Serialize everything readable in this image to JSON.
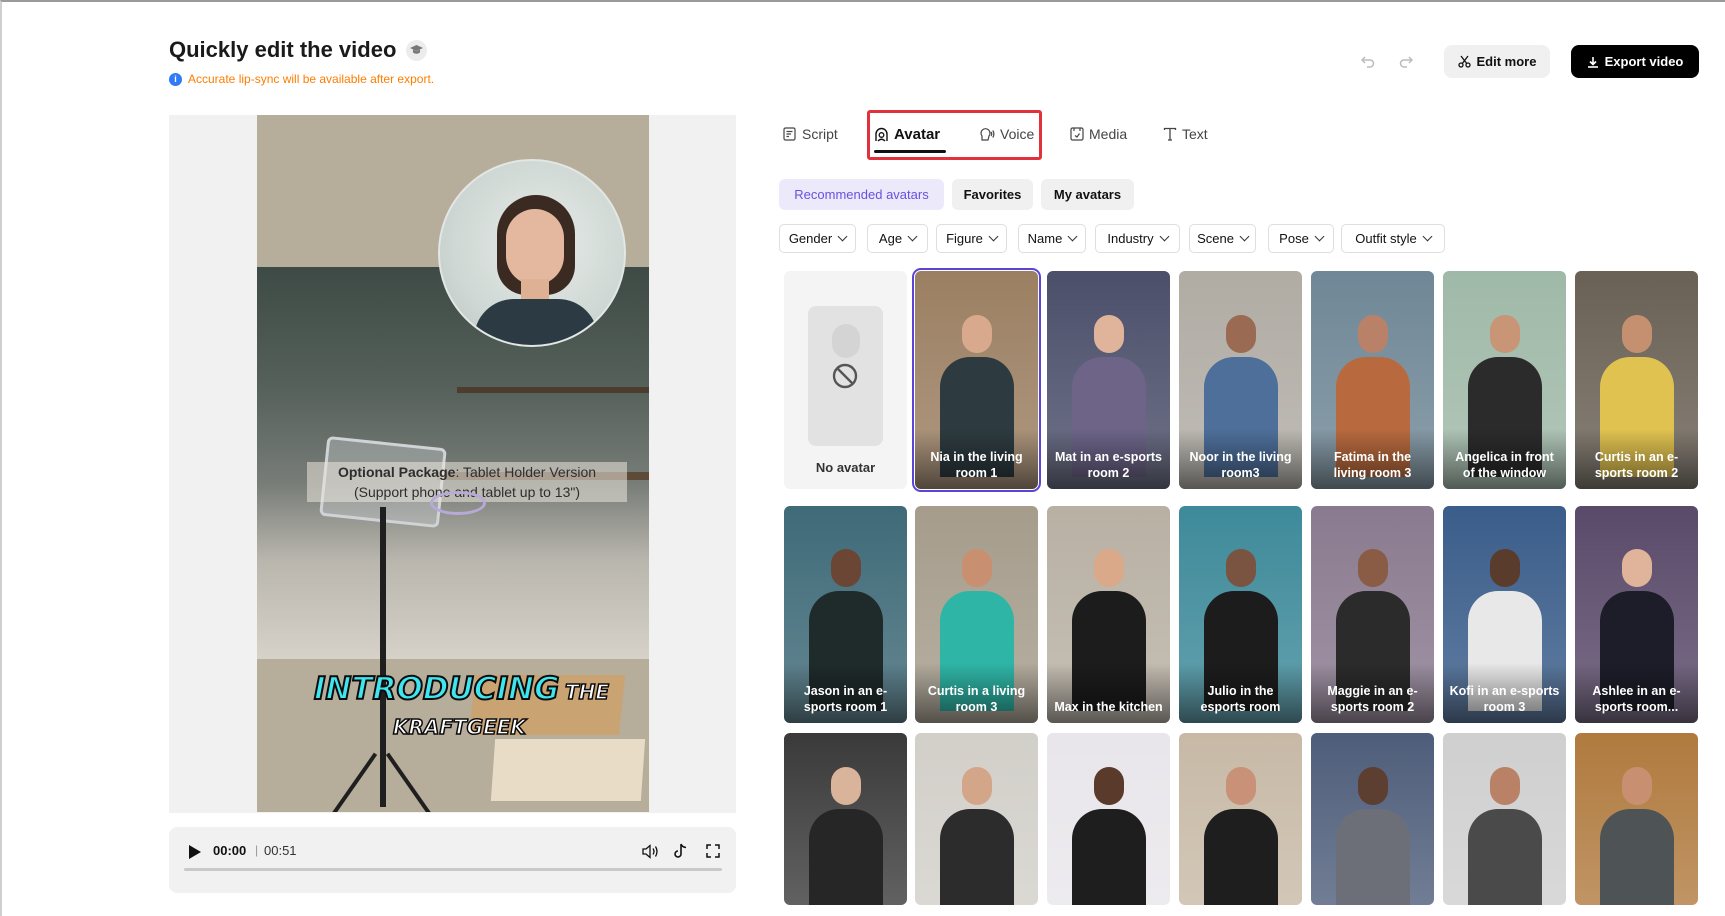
{
  "header": {
    "title": "Quickly edit the video",
    "notice": "Accurate lip-sync will be available after export.",
    "edit_more": "Edit more",
    "export": "Export video"
  },
  "preview": {
    "caption_bold": "Optional Package",
    "caption_rest": ": Tablet Holder Version",
    "caption_line2": "(Support phone and tablet up to 13\")",
    "headline": "INTRODUCING",
    "headline_the": "THE",
    "brand": "KRAFTGEEK"
  },
  "player": {
    "current_time": "00:00",
    "separator": "|",
    "total_time": "00:51",
    "progress": 0
  },
  "tabs": [
    {
      "label": "Script",
      "icon": "script-icon"
    },
    {
      "label": "Avatar",
      "icon": "avatar-icon",
      "active": true
    },
    {
      "label": "Voice",
      "icon": "voice-icon"
    },
    {
      "label": "Media",
      "icon": "media-icon"
    },
    {
      "label": "Text",
      "icon": "text-icon"
    }
  ],
  "avatar_tabs": [
    {
      "label": "Recommended avatars",
      "active": true
    },
    {
      "label": "Favorites"
    },
    {
      "label": "My avatars"
    }
  ],
  "filters": [
    "Gender",
    "Age",
    "Figure",
    "Name",
    "Industry",
    "Scene",
    "Pose",
    "Outfit style"
  ],
  "avatars": [
    {
      "label": "No avatar",
      "bg": "#f4f4f4"
    },
    {
      "label": "Nia in the living room 1",
      "bg": "#9b7f62",
      "skin": "#d8a98c",
      "cloth": "#2d3b40",
      "selected": true
    },
    {
      "label": "Mat in an e-sports room 2",
      "bg": "#4b4f6a",
      "skin": "#e0b49a",
      "cloth": "#6d6488"
    },
    {
      "label": "Noor in the living room3",
      "bg": "#b0aca4",
      "skin": "#9a6b52",
      "cloth": "#4e6f9a"
    },
    {
      "label": "Fatima in the living room 3",
      "bg": "#6f8796",
      "skin": "#b98268",
      "cloth": "#b86a3e"
    },
    {
      "label": "Angelica in front of the window",
      "bg": "#9fb9a8",
      "skin": "#c89577",
      "cloth": "#2b2b2b"
    },
    {
      "label": "Curtis in an e-sports room 2",
      "bg": "#6a6155",
      "skin": "#c59070",
      "cloth": "#e0c250"
    },
    {
      "label": "Jason in an e-sports room 1",
      "bg": "#3f6a78",
      "skin": "#6b4634",
      "cloth": "#1f2a2a"
    },
    {
      "label": "Curtis in a living room 3",
      "bg": "#a59c8b",
      "skin": "#c89070",
      "cloth": "#2fb5a6"
    },
    {
      "label": "Max in the kitchen",
      "bg": "#b8b0a3",
      "skin": "#d9a98a",
      "cloth": "#1c1c1c"
    },
    {
      "label": "Julio in the esports room",
      "bg": "#3e8a9a",
      "skin": "#7a5440",
      "cloth": "#1c1c1c"
    },
    {
      "label": "Maggie in an e-sports room 2",
      "bg": "#8a7a8f",
      "skin": "#8a5c46",
      "cloth": "#2b2b2b"
    },
    {
      "label": "Kofi in an e-sports room 3",
      "bg": "#3a5d8a",
      "skin": "#5a3c2c",
      "cloth": "#e8e8e8"
    },
    {
      "label": "Ashlee in an e-sports room...",
      "bg": "#5a4a6a",
      "skin": "#e0b49a",
      "cloth": "#1d1d2a"
    },
    {
      "label": "",
      "bg": "#3a3a3a",
      "skin": "#d9b39a",
      "cloth": "#262626"
    },
    {
      "label": "",
      "bg": "#d2cfc9",
      "skin": "#d3a68a",
      "cloth": "#2c2c2c"
    },
    {
      "label": "",
      "bg": "#e8e6ea",
      "skin": "#5a3a2a",
      "cloth": "#1e1e1e"
    },
    {
      "label": "",
      "bg": "#c7b9a6",
      "skin": "#c99278",
      "cloth": "#1e1e1e"
    },
    {
      "label": "",
      "bg": "#4e5d7a",
      "skin": "#5c3f30",
      "cloth": "#6d6f78"
    },
    {
      "label": "",
      "bg": "#cfcfcf",
      "skin": "#b98266",
      "cloth": "#4a4a4a"
    },
    {
      "label": "",
      "bg": "#b07a3e",
      "skin": "#c89070",
      "cloth": "#4e5356"
    }
  ],
  "colors": {
    "accent": "#6a50e0",
    "notice": "#ff7d00",
    "highlight": "#e0313c"
  }
}
